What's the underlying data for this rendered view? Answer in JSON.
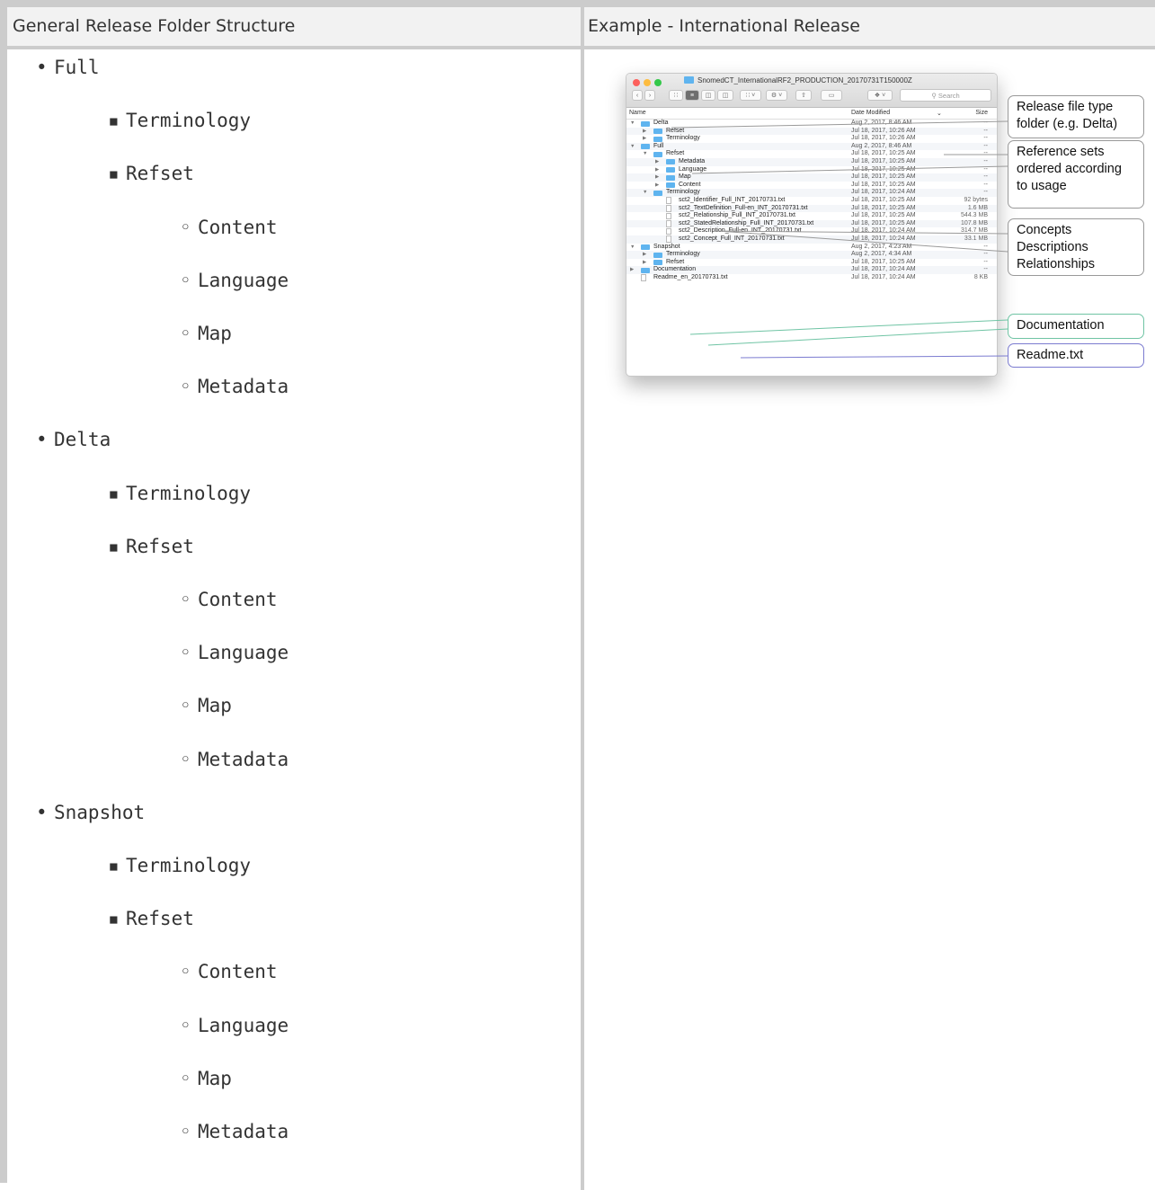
{
  "table": {
    "left_header": "General Release Folder Structure",
    "right_header": "Example - International Release"
  },
  "tree": [
    {
      "label": "Full",
      "children": [
        {
          "label": "Terminology"
        },
        {
          "label": "Refset",
          "children": [
            {
              "label": "Content"
            },
            {
              "label": "Language"
            },
            {
              "label": "Map"
            },
            {
              "label": "Metadata"
            }
          ]
        }
      ]
    },
    {
      "label": "Delta",
      "children": [
        {
          "label": "Terminology"
        },
        {
          "label": "Refset",
          "children": [
            {
              "label": "Content"
            },
            {
              "label": "Language"
            },
            {
              "label": "Map"
            },
            {
              "label": "Metadata"
            }
          ]
        }
      ]
    },
    {
      "label": "Snapshot",
      "children": [
        {
          "label": "Terminology"
        },
        {
          "label": "Refset",
          "children": [
            {
              "label": "Content"
            },
            {
              "label": "Language"
            },
            {
              "label": "Map"
            },
            {
              "label": "Metadata"
            }
          ]
        }
      ]
    }
  ],
  "finder": {
    "title": "SnomedCT_InternationalRF2_PRODUCTION_20170731T150000Z",
    "search_placeholder": "Search",
    "columns": {
      "name": "Name",
      "date": "Date Modified",
      "size": "Size"
    },
    "rows": [
      {
        "indent": 0,
        "kind": "folder-open",
        "name": "Delta",
        "date": "Aug 2, 2017, 8:46 AM",
        "size": "--"
      },
      {
        "indent": 1,
        "kind": "folder",
        "name": "Refset",
        "date": "Jul 18, 2017, 10:26 AM",
        "size": "--"
      },
      {
        "indent": 1,
        "kind": "folder",
        "name": "Terminology",
        "date": "Jul 18, 2017, 10:26 AM",
        "size": "--"
      },
      {
        "indent": 0,
        "kind": "folder-open",
        "name": "Full",
        "date": "Aug 2, 2017, 8:46 AM",
        "size": "--"
      },
      {
        "indent": 1,
        "kind": "folder-open",
        "name": "Refset",
        "date": "Jul 18, 2017, 10:25 AM",
        "size": "--"
      },
      {
        "indent": 2,
        "kind": "folder",
        "name": "Metadata",
        "date": "Jul 18, 2017, 10:25 AM",
        "size": "--"
      },
      {
        "indent": 2,
        "kind": "folder",
        "name": "Language",
        "date": "Jul 18, 2017, 10:25 AM",
        "size": "--"
      },
      {
        "indent": 2,
        "kind": "folder",
        "name": "Map",
        "date": "Jul 18, 2017, 10:25 AM",
        "size": "--"
      },
      {
        "indent": 2,
        "kind": "folder",
        "name": "Content",
        "date": "Jul 18, 2017, 10:25 AM",
        "size": "--"
      },
      {
        "indent": 1,
        "kind": "folder-open",
        "name": "Terminology",
        "date": "Jul 18, 2017, 10:24 AM",
        "size": "--"
      },
      {
        "indent": 2,
        "kind": "file",
        "name": "sct2_Identifier_Full_INT_20170731.txt",
        "date": "Jul 18, 2017, 10:25 AM",
        "size": "92 bytes"
      },
      {
        "indent": 2,
        "kind": "file",
        "name": "sct2_TextDefinition_Full-en_INT_20170731.txt",
        "date": "Jul 18, 2017, 10:25 AM",
        "size": "1.6 MB"
      },
      {
        "indent": 2,
        "kind": "file",
        "name": "sct2_Relationship_Full_INT_20170731.txt",
        "date": "Jul 18, 2017, 10:25 AM",
        "size": "544.3 MB"
      },
      {
        "indent": 2,
        "kind": "file",
        "name": "sct2_StatedRelationship_Full_INT_20170731.txt",
        "date": "Jul 18, 2017, 10:25 AM",
        "size": "107.8 MB"
      },
      {
        "indent": 2,
        "kind": "file",
        "name": "sct2_Description_Full-en_INT_20170731.txt",
        "date": "Jul 18, 2017, 10:24 AM",
        "size": "314.7 MB"
      },
      {
        "indent": 2,
        "kind": "file",
        "name": "sct2_Concept_Full_INT_20170731.txt",
        "date": "Jul 18, 2017, 10:24 AM",
        "size": "33.1 MB"
      },
      {
        "indent": 0,
        "kind": "folder-open",
        "name": "Snapshot",
        "date": "Aug 2, 2017, 4:23 AM",
        "size": "--"
      },
      {
        "indent": 1,
        "kind": "folder",
        "name": "Terminology",
        "date": "Aug 2, 2017, 4:34 AM",
        "size": "--"
      },
      {
        "indent": 1,
        "kind": "folder",
        "name": "Refset",
        "date": "Jul 18, 2017, 10:25 AM",
        "size": "--"
      },
      {
        "indent": 0,
        "kind": "folder",
        "name": "Documentation",
        "date": "Jul 18, 2017, 10:24 AM",
        "size": "--"
      },
      {
        "indent": 0,
        "kind": "file",
        "name": "Readme_en_20170731.txt",
        "date": "Jul 18, 2017, 10:24 AM",
        "size": "8 KB"
      }
    ]
  },
  "callouts": {
    "release_type": [
      "Release file type",
      "folder (e.g. Delta)"
    ],
    "reference_sets": [
      "Reference sets",
      "ordered according",
      "to usage"
    ],
    "concepts": [
      "Concepts",
      "Descriptions",
      "Relationships"
    ],
    "documentation": "Documentation",
    "readme": "Readme.txt"
  },
  "colors": {
    "folder": "#5fb4ef",
    "close": "#fc605c",
    "minimize": "#fdbc40",
    "zoom": "#34c84a",
    "callout_green": "#6fc4a4",
    "callout_purple": "#7b7bd0"
  }
}
